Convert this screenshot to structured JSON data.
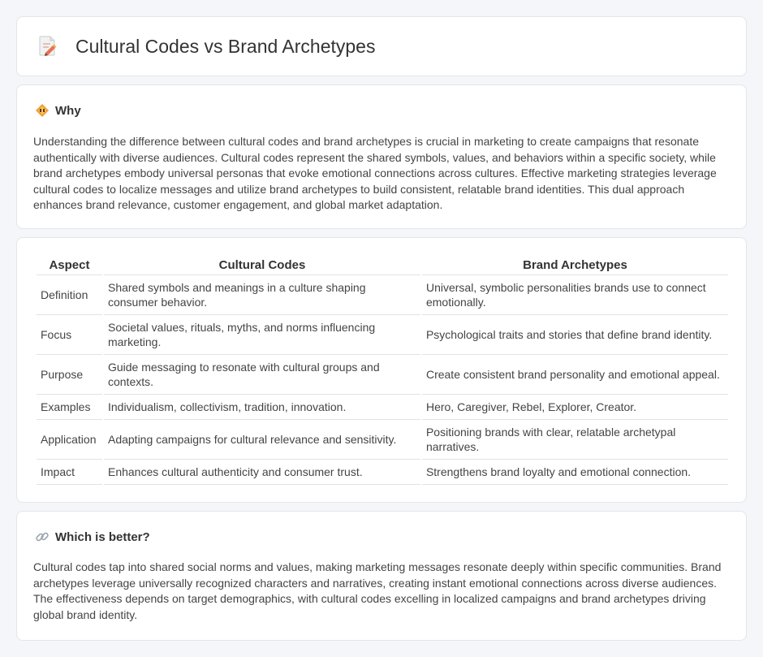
{
  "header": {
    "title": "Cultural Codes vs Brand Archetypes",
    "icon": "document-pencil-icon"
  },
  "why": {
    "title": "Why",
    "icon": "diamond-warning-icon",
    "text": "Understanding the difference between cultural codes and brand archetypes is crucial in marketing to create campaigns that resonate authentically with diverse audiences. Cultural codes represent the shared symbols, values, and behaviors within a specific society, while brand archetypes embody universal personas that evoke emotional connections across cultures. Effective marketing strategies leverage cultural codes to localize messages and utilize brand archetypes to build consistent, relatable brand identities. This dual approach enhances brand relevance, customer engagement, and global market adaptation."
  },
  "table": {
    "headers": [
      "Aspect",
      "Cultural Codes",
      "Brand Archetypes"
    ],
    "rows": [
      [
        "Definition",
        "Shared symbols and meanings in a culture shaping consumer behavior.",
        "Universal, symbolic personalities brands use to connect emotionally."
      ],
      [
        "Focus",
        "Societal values, rituals, myths, and norms influencing marketing.",
        "Psychological traits and stories that define brand identity."
      ],
      [
        "Purpose",
        "Guide messaging to resonate with cultural groups and contexts.",
        "Create consistent brand personality and emotional appeal."
      ],
      [
        "Examples",
        "Individualism, collectivism, tradition, innovation.",
        "Hero, Caregiver, Rebel, Explorer, Creator."
      ],
      [
        "Application",
        "Adapting campaigns for cultural relevance and sensitivity.",
        "Positioning brands with clear, relatable archetypal narratives."
      ],
      [
        "Impact",
        "Enhances cultural authenticity and consumer trust.",
        "Strengthens brand loyalty and emotional connection."
      ]
    ]
  },
  "better": {
    "title": "Which is better?",
    "icon": "link-icon",
    "text": "Cultural codes tap into shared social norms and values, making marketing messages resonate deeply within specific communities. Brand archetypes leverage universally recognized characters and narratives, creating instant emotional connections across diverse audiences. The effectiveness depends on target demographics, with cultural codes excelling in localized campaigns and brand archetypes driving global brand identity."
  },
  "colors": {
    "background": "#f4f6f9",
    "card": "#ffffff",
    "border": "#e3e6ea",
    "accent": "#f0a030"
  }
}
